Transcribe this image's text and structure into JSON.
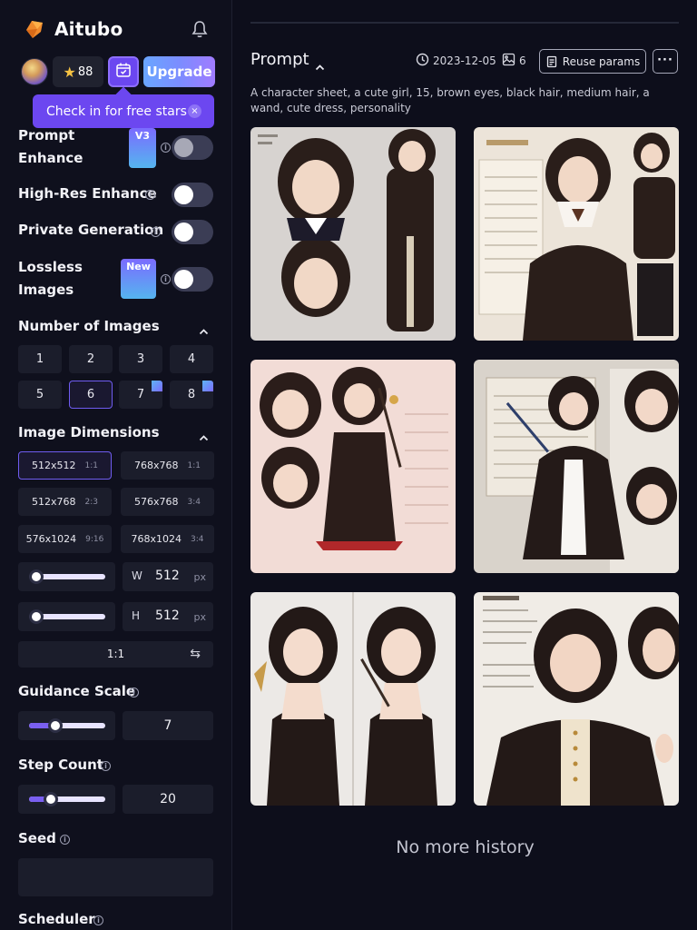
{
  "app": {
    "name": "Aitubo"
  },
  "account": {
    "stars": "88",
    "upgrade_label": "Upgrade"
  },
  "tooltip": {
    "text": "Check in for free stars",
    "close": "×"
  },
  "settings": {
    "prompt_enhance": {
      "label": "Prompt Enhance",
      "badge": "V3",
      "enabled": false
    },
    "high_res": {
      "label": "High-Res Enhance",
      "enabled": false
    },
    "private_gen": {
      "label": "Private Generation",
      "enabled": false
    },
    "lossless": {
      "label": "Lossless Images",
      "badge": "New",
      "enabled": false
    }
  },
  "number_of_images": {
    "title": "Number of Images",
    "options": [
      "1",
      "2",
      "3",
      "4",
      "5",
      "6",
      "7",
      "8"
    ],
    "selected": "6"
  },
  "image_dimensions": {
    "title": "Image Dimensions",
    "options": [
      {
        "size": "512x512",
        "ratio": "1:1"
      },
      {
        "size": "768x768",
        "ratio": "1:1"
      },
      {
        "size": "512x768",
        "ratio": "2:3"
      },
      {
        "size": "576x768",
        "ratio": "3:4"
      },
      {
        "size": "576x1024",
        "ratio": "9:16"
      },
      {
        "size": "768x1024",
        "ratio": "3:4"
      }
    ],
    "selected": "512x512",
    "width": {
      "label": "W",
      "value": "512",
      "unit": "px"
    },
    "height": {
      "label": "H",
      "value": "512",
      "unit": "px"
    },
    "aspect_ratio": "1:1",
    "swap_icon": "⇆"
  },
  "guidance_scale": {
    "title": "Guidance Scale",
    "value": "7",
    "level": 0.35
  },
  "step_count": {
    "title": "Step Count",
    "value": "20",
    "level": 0.28
  },
  "seed": {
    "title": "Seed",
    "value": ""
  },
  "scheduler": {
    "title": "Scheduler"
  },
  "history": {
    "title": "Prompt",
    "date": "2023-12-05",
    "image_count": "6",
    "reuse_label": "Reuse params",
    "more_label": "···",
    "prompt": "A character sheet, a cute girl, 15, brown eyes, black hair, medium hair, a wand, cute dress, personality",
    "footer": "No more history"
  },
  "colors": {
    "background": "#0d0e1b",
    "sidebar": "#0f101d",
    "accent": "#6b47f0",
    "upgrade_gradient_start": "#6aa6ff",
    "upgrade_gradient_end": "#a07bff",
    "tile": "#1b1d2b"
  }
}
